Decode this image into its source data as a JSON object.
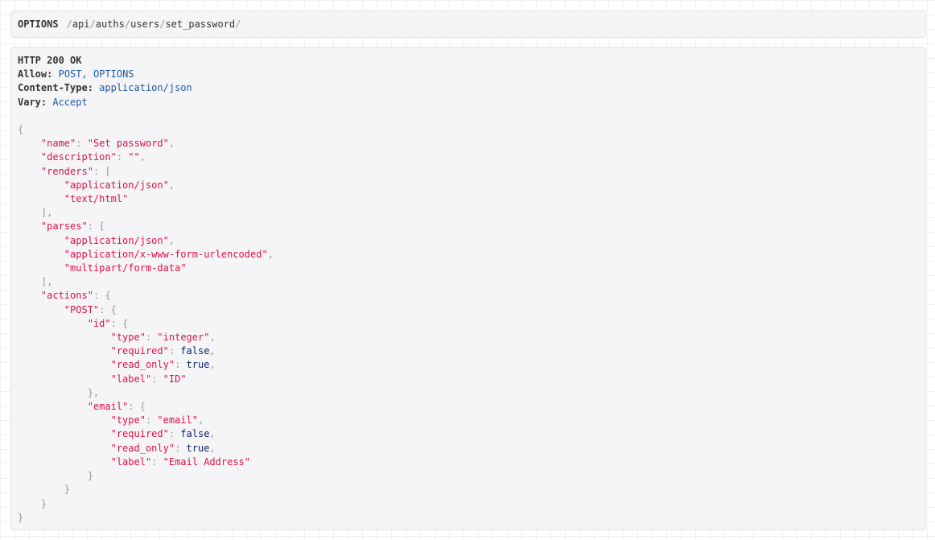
{
  "request": {
    "method": "OPTIONS",
    "path_segments": [
      "api",
      "auths",
      "users",
      "set_password"
    ]
  },
  "response": {
    "status_line": "HTTP 200 OK",
    "headers": [
      {
        "key": "Allow:",
        "value": "POST, OPTIONS"
      },
      {
        "key": "Content-Type:",
        "value": "application/json"
      },
      {
        "key": "Vary:",
        "value": "Accept"
      }
    ],
    "body": {
      "name": "Set password",
      "description": "",
      "renders": [
        "application/json",
        "text/html"
      ],
      "parses": [
        "application/json",
        "application/x-www-form-urlencoded",
        "multipart/form-data"
      ],
      "actions": {
        "POST": {
          "id": {
            "type": "integer",
            "required": false,
            "read_only": true,
            "label": "ID"
          },
          "email": {
            "type": "email",
            "required": false,
            "read_only": true,
            "label": "Email Address"
          }
        }
      }
    }
  }
}
